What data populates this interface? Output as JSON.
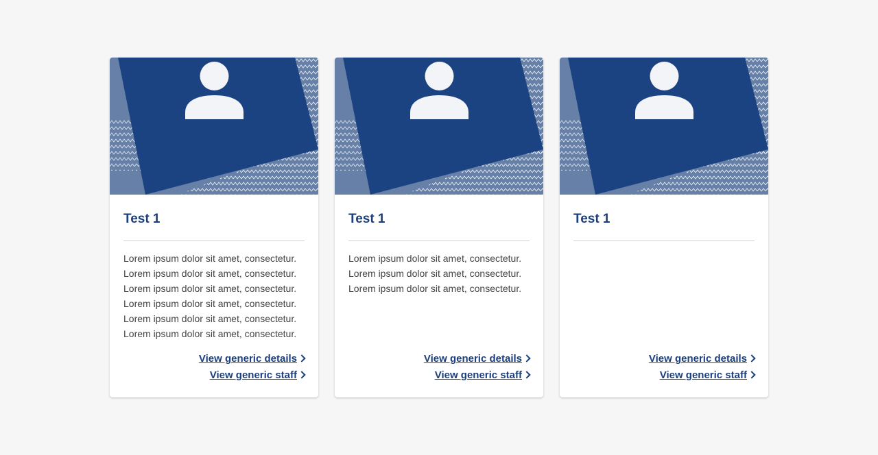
{
  "colors": {
    "page_background": "#f6f6f6",
    "card_background": "#ffffff",
    "banner_dark": "#1b4281",
    "banner_light": "#6680a8",
    "avatar": "#f3f4f8",
    "title_text": "#1b3f7c",
    "body_text": "#444444",
    "link_text": "#1b3f7c"
  },
  "cards": [
    {
      "image_icon": "user-avatar-icon",
      "title": "Test 1",
      "description": [
        "Lorem ipsum dolor sit amet, consectetur.",
        "Lorem ipsum dolor sit amet, consectetur.",
        "Lorem ipsum dolor sit amet, consectetur.",
        "Lorem ipsum dolor sit amet, consectetur.",
        "Lorem ipsum dolor sit amet, consectetur.",
        "Lorem ipsum dolor sit amet, consectetur."
      ],
      "links": {
        "details": "View generic details",
        "staff": "View generic staff"
      }
    },
    {
      "image_icon": "user-avatar-icon",
      "title": "Test 1",
      "description": [
        "Lorem ipsum dolor sit amet, consectetur.",
        "Lorem ipsum dolor sit amet, consectetur.",
        "Lorem ipsum dolor sit amet, consectetur."
      ],
      "links": {
        "details": "View generic details",
        "staff": "View generic staff"
      }
    },
    {
      "image_icon": "user-avatar-icon",
      "title": "Test 1",
      "description": [],
      "links": {
        "details": "View generic details",
        "staff": "View generic staff"
      }
    }
  ]
}
